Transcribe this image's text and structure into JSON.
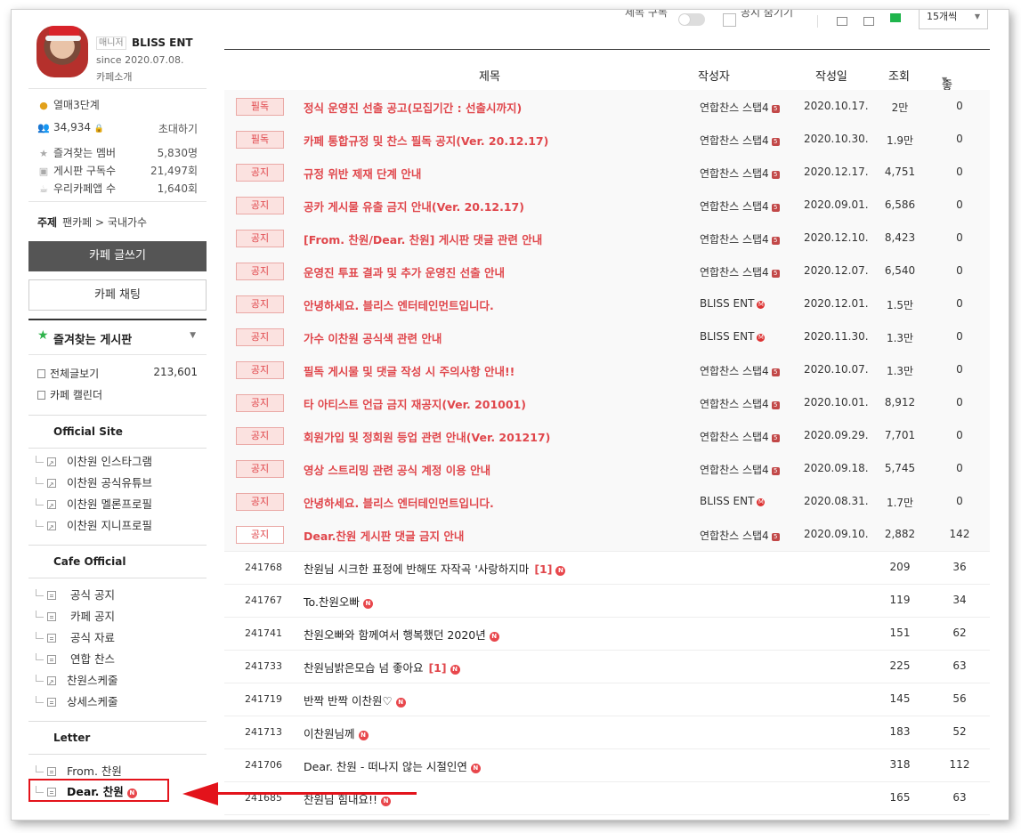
{
  "profile": {
    "manager_badge": "매니저",
    "name": "BLISS ENT",
    "since": "since 2020.07.08.",
    "cafe_intro": "카페소개"
  },
  "stats": {
    "level": "열매3단계",
    "members": "34,934",
    "invite": "초대하기",
    "fav_members_label": "즐겨찾는 멤버",
    "fav_members_value": "5,830명",
    "board_subs_label": "게시판 구독수",
    "board_subs_value": "21,497회",
    "app_label": "우리카페앱 수",
    "app_value": "1,640회"
  },
  "topic": {
    "label": "주제",
    "value": "팬카페 > 국내가수"
  },
  "buttons": {
    "write": "카페 글쓰기",
    "chat": "카페 채팅"
  },
  "favorites": {
    "title": "즐겨찾는 게시판"
  },
  "all_posts": {
    "label": "전체글보기",
    "count": "213,601"
  },
  "calendar": "카페 캘린더",
  "sections": [
    {
      "title": "Official Site",
      "items": [
        "이찬원 인스타그램",
        "이찬원 공식유튜브",
        "이찬원 멜론프로필",
        "이찬원 지니프로필"
      ]
    },
    {
      "title": "Cafe Official",
      "items": [
        "공식 공지",
        "카페 공지",
        "공식 자료",
        "연합 찬스",
        "찬원스케줄",
        "상세스케줄"
      ]
    },
    {
      "title": "Letter",
      "items": [
        "From. 찬원",
        "Dear. 찬원"
      ]
    }
  ],
  "new_badge": "N",
  "toolbar": {
    "label1": "제목 구독",
    "label2": "공지 숨기기",
    "per_page": "15개씩"
  },
  "columns": {
    "title": "제목",
    "author": "작성자",
    "date": "작성일",
    "views": "조회",
    "likes": "좋아요"
  },
  "notices": [
    {
      "tag": "필독",
      "title": "정식 운영진 선출 공고(모집기간 : 선출시까지)",
      "author": "연합찬스 스탭4",
      "date": "2020.10.17.",
      "views": "2만",
      "likes": "0"
    },
    {
      "tag": "필독",
      "title": "카페 통합규정 및 찬스 필독 공지(Ver. 20.12.17)",
      "author": "연합찬스 스탭4",
      "date": "2020.10.30.",
      "views": "1.9만",
      "likes": "0"
    },
    {
      "tag": "공지",
      "title": "규정 위반 제재 단계 안내",
      "author": "연합찬스 스탭4",
      "date": "2020.12.17.",
      "views": "4,751",
      "likes": "0"
    },
    {
      "tag": "공지",
      "title": "공카 게시물 유출 금지 안내(Ver. 20.12.17)",
      "author": "연합찬스 스탭4",
      "date": "2020.09.01.",
      "views": "6,586",
      "likes": "0"
    },
    {
      "tag": "공지",
      "title": "[From. 찬원/Dear. 찬원] 게시판 댓글 관련 안내",
      "author": "연합찬스 스탭4",
      "date": "2020.12.10.",
      "views": "8,423",
      "likes": "0"
    },
    {
      "tag": "공지",
      "title": "운영진 투표 결과 및 추가 운영진 선출 안내",
      "author": "연합찬스 스탭4",
      "date": "2020.12.07.",
      "views": "6,540",
      "likes": "0"
    },
    {
      "tag": "공지",
      "title": "안녕하세요. 블리스 엔터테인먼트입니다.",
      "author": "BLISS ENT",
      "date": "2020.12.01.",
      "views": "1.5만",
      "likes": "0"
    },
    {
      "tag": "공지",
      "title": "가수 이찬원 공식색 관련 안내",
      "author": "BLISS ENT",
      "date": "2020.11.30.",
      "views": "1.3만",
      "likes": "0"
    },
    {
      "tag": "공지",
      "title": "필독 게시물 및 댓글 작성 시 주의사항 안내!!",
      "author": "연합찬스 스탭4",
      "date": "2020.10.07.",
      "views": "1.3만",
      "likes": "0"
    },
    {
      "tag": "공지",
      "title": "타 아티스트 언급 금지 재공지(Ver. 201001)",
      "author": "연합찬스 스탭4",
      "date": "2020.10.01.",
      "views": "8,912",
      "likes": "0"
    },
    {
      "tag": "공지",
      "title": "회원가입 및 정회원 등업 관련 안내(Ver. 201217)",
      "author": "연합찬스 스탭4",
      "date": "2020.09.29.",
      "views": "7,701",
      "likes": "0"
    },
    {
      "tag": "공지",
      "title": "영상 스트리밍 관련 공식 계정 이용 안내",
      "author": "연합찬스 스탭4",
      "date": "2020.09.18.",
      "views": "5,745",
      "likes": "0"
    },
    {
      "tag": "공지",
      "title": "안녕하세요. 블리스 엔터테인먼트입니다.",
      "author": "BLISS ENT",
      "date": "2020.08.31.",
      "views": "1.7만",
      "likes": "0"
    },
    {
      "tag": "공지",
      "title": "Dear.찬원 게시판 댓글 금지 안내",
      "author": "연합찬스 스탭4",
      "date": "2020.09.10.",
      "views": "2,882",
      "likes": "142"
    }
  ],
  "posts": [
    {
      "num": "241768",
      "title": "찬원님 시크한 표정에 반해또 자작곡 '사랑하지마",
      "comments": "[1]",
      "views": "209",
      "likes": "36"
    },
    {
      "num": "241767",
      "title": "To.찬원오빠",
      "comments": "",
      "views": "119",
      "likes": "34"
    },
    {
      "num": "241741",
      "title": "찬원오빠와 함께여서 행복했던 2020년",
      "comments": "",
      "views": "151",
      "likes": "62"
    },
    {
      "num": "241733",
      "title": "찬원님밝은모습 넘 좋아요",
      "comments": "[1]",
      "views": "225",
      "likes": "63"
    },
    {
      "num": "241719",
      "title": "반짝 반짝 이찬원♡",
      "comments": "",
      "views": "145",
      "likes": "56"
    },
    {
      "num": "241713",
      "title": "이찬원님께",
      "comments": "",
      "views": "183",
      "likes": "52"
    },
    {
      "num": "241706",
      "title": "Dear. 찬원 - 떠나지 않는 시절인연",
      "comments": "",
      "views": "318",
      "likes": "112"
    },
    {
      "num": "241685",
      "title": "찬원님 힘내요!!",
      "comments": "",
      "views": "165",
      "likes": "63"
    }
  ],
  "colors": {
    "accent_red": "#e0474c",
    "highlight_red": "#e3131b",
    "green": "#1fb54c",
    "write_button": "#555555"
  }
}
